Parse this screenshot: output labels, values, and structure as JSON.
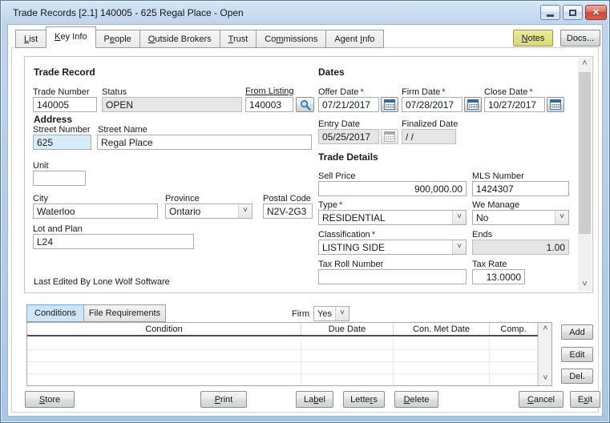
{
  "window": {
    "title": "Trade Records [2.1] 140005 - 625 Regal Place - Open"
  },
  "icons": {
    "close": "✕",
    "minimize": "minimize-bar",
    "restore": "restore-box",
    "chevron_down": "˅",
    "scroll_up": "˄",
    "scroll_down": "˅",
    "search": "magnifier",
    "calendar": "calendar-grid"
  },
  "ui": {
    "required_marker": "*"
  },
  "tabs": [
    {
      "pre": "",
      "key": "L",
      "post": "ist",
      "active": false
    },
    {
      "pre": "",
      "key": "K",
      "post": "ey Info",
      "active": true
    },
    {
      "pre": "P",
      "key": "e",
      "post": "ople",
      "active": false
    },
    {
      "pre": "",
      "key": "O",
      "post": "utside Brokers",
      "active": false
    },
    {
      "pre": "",
      "key": "T",
      "post": "rust",
      "active": false
    },
    {
      "pre": "Co",
      "key": "m",
      "post": "missions",
      "active": false
    },
    {
      "pre": "Agent ",
      "key": "I",
      "post": "nfo",
      "active": false
    }
  ],
  "header_buttons": {
    "notes": {
      "pre": "",
      "key": "N",
      "post": "otes"
    },
    "docs": {
      "label": "Docs..."
    }
  },
  "form": {
    "sections": {
      "trade_record": "Trade Record",
      "address": "Address",
      "dates": "Dates",
      "trade_details": "Trade Details"
    },
    "fields": {
      "trade_number": {
        "label": "Trade Number",
        "value": "140005"
      },
      "status": {
        "label": "Status",
        "value": "OPEN"
      },
      "from_listing": {
        "label": "From Listing",
        "value": "140003"
      },
      "street_number": {
        "label": "Street Number",
        "value": "625"
      },
      "street_name": {
        "label": "Street Name",
        "value": "Regal Place"
      },
      "unit": {
        "label": "Unit",
        "value": ""
      },
      "city": {
        "label": "City",
        "value": "Waterloo"
      },
      "province": {
        "label": "Province",
        "value": "Ontario"
      },
      "postal_code": {
        "label": "Postal Code",
        "value": "N2V-2G3"
      },
      "lot_and_plan": {
        "label": "Lot and Plan",
        "value": "L24"
      },
      "offer_date": {
        "label": "Offer Date",
        "value": "07/21/2017",
        "required": true
      },
      "firm_date": {
        "label": "Firm Date",
        "value": "07/28/2017",
        "required": true
      },
      "close_date": {
        "label": "Close Date",
        "value": "10/27/2017",
        "required": true
      },
      "entry_date": {
        "label": "Entry Date",
        "value": "05/25/2017"
      },
      "finalized_date": {
        "label": "Finalized Date",
        "value": "/ /"
      },
      "sell_price": {
        "label": "Sell Price",
        "value": "900,000.00"
      },
      "mls_number": {
        "label": "MLS Number",
        "value": "1424307"
      },
      "type": {
        "label": "Type",
        "value": "RESIDENTIAL",
        "required": true
      },
      "we_manage": {
        "label": "We Manage",
        "value": "No"
      },
      "classification": {
        "label": "Classification",
        "value": "LISTING SIDE",
        "required": true
      },
      "ends": {
        "label": "Ends",
        "value": "1.00"
      },
      "tax_roll_number": {
        "label": "Tax Roll Number",
        "value": ""
      },
      "tax_rate": {
        "label": "Tax Rate",
        "value": "13.0000"
      }
    },
    "footer_note": "Last Edited By Lone Wolf Software"
  },
  "conditions_panel": {
    "tabs": [
      {
        "label": "Conditions",
        "active": true
      },
      {
        "label": "File Requirements",
        "active": false
      }
    ],
    "firm": {
      "label": "Firm",
      "value": "Yes"
    },
    "grid": {
      "columns": [
        "Condition",
        "Due Date",
        "Con. Met Date",
        "Comp."
      ],
      "rows": []
    },
    "side_buttons": [
      "Add",
      "Edit",
      "Del."
    ]
  },
  "footer_buttons": {
    "store": {
      "pre": "",
      "key": "S",
      "post": "tore"
    },
    "print": {
      "pre": "",
      "key": "P",
      "post": "rint"
    },
    "label": {
      "pre": "La",
      "key": "b",
      "post": "el"
    },
    "letters": {
      "pre": "Lette",
      "key": "r",
      "post": "s"
    },
    "delete": {
      "pre": "",
      "key": "D",
      "post": "elete"
    },
    "cancel": {
      "pre": "",
      "key": "C",
      "post": "ancel"
    },
    "exit": {
      "pre": "E",
      "key": "x",
      "post": "it"
    }
  },
  "colors": {
    "titlebar": "#bfd5ec",
    "close_button": "#c94837",
    "notes_button": "#dfe08a",
    "focused_field": "#d6ecf9",
    "active_subtab": "#cee4f7",
    "required": "#cc0000",
    "disabled_field_bg": "#e6e6e6"
  }
}
